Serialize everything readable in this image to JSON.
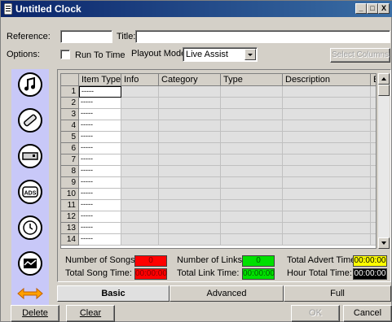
{
  "window": {
    "title": "Untitled Clock",
    "minimize": "_",
    "restore": "□",
    "close": "X"
  },
  "form": {
    "reference_label": "Reference:",
    "reference_value": "",
    "title_label": "Title:",
    "title_value": "",
    "options_label": "Options:",
    "run_to_time_label": "Run To Time",
    "run_to_time_checked": false,
    "playout_mode_label": "Playout Mode:",
    "playout_mode_value": "Live Assist",
    "select_columns_label": "Select Columns"
  },
  "toolbar": {
    "tools": [
      {
        "name": "song-tool-icon"
      },
      {
        "name": "link-tool-icon"
      },
      {
        "name": "cart-tool-icon"
      },
      {
        "name": "ads-tool-icon",
        "text": "ADS"
      },
      {
        "name": "clock-tool-icon"
      },
      {
        "name": "wave-tool-icon"
      },
      {
        "name": "swap-arrows-icon"
      }
    ]
  },
  "grid": {
    "columns": [
      "",
      "Item Type",
      "Info",
      "Category",
      "Type",
      "Description",
      "E"
    ],
    "rows": [
      {
        "num": "1",
        "item_type": "-----"
      },
      {
        "num": "2",
        "item_type": "-----"
      },
      {
        "num": "3",
        "item_type": "-----"
      },
      {
        "num": "4",
        "item_type": "-----"
      },
      {
        "num": "5",
        "item_type": "-----"
      },
      {
        "num": "6",
        "item_type": "-----"
      },
      {
        "num": "7",
        "item_type": "-----"
      },
      {
        "num": "8",
        "item_type": "-----"
      },
      {
        "num": "9",
        "item_type": "-----"
      },
      {
        "num": "10",
        "item_type": "-----"
      },
      {
        "num": "11",
        "item_type": "-----"
      },
      {
        "num": "12",
        "item_type": "-----"
      },
      {
        "num": "13",
        "item_type": "-----"
      },
      {
        "num": "14",
        "item_type": "-----"
      }
    ]
  },
  "stats": {
    "num_songs_label": "Number of Songs:",
    "num_songs_value": "0",
    "total_song_time_label": "Total Song Time:",
    "total_song_time_value": "00:00:00",
    "num_links_label": "Number of Links:",
    "num_links_value": "0",
    "total_link_time_label": "Total Link Time:",
    "total_link_time_value": "00:00:00",
    "total_advert_time_label": "Total Advert Time:",
    "total_advert_time_value": "00:00:00",
    "hour_total_time_label": "Hour Total Time:",
    "hour_total_time_value": "00:00:00"
  },
  "tabs": [
    {
      "label": "Basic",
      "active": true
    },
    {
      "label": "Advanced",
      "active": false
    },
    {
      "label": "Full",
      "active": false
    }
  ],
  "buttons": {
    "delete": "Delete",
    "clear": "Clear",
    "ok": "OK",
    "cancel": "Cancel"
  },
  "colors": {
    "songs": "#ff0000",
    "links": "#00e000",
    "advert": "#ffff00",
    "hour": "#000000",
    "toolbar_bg": "#c8c8f8"
  }
}
